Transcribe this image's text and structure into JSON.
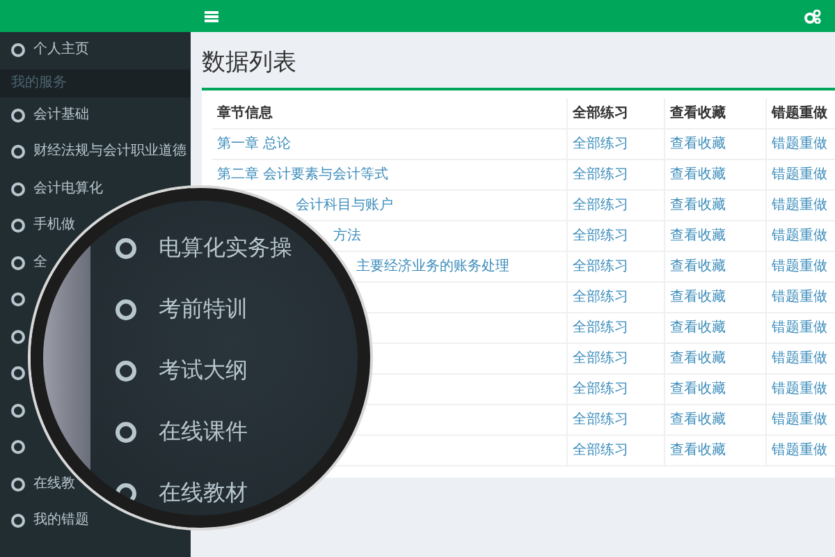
{
  "sidebar": {
    "items": [
      {
        "kind": "item",
        "label": "个人主页"
      },
      {
        "kind": "section",
        "label": "我的服务"
      },
      {
        "kind": "item",
        "label": "会计基础"
      },
      {
        "kind": "item",
        "label": "财经法规与会计职业道德"
      },
      {
        "kind": "item",
        "label": "会计电算化"
      },
      {
        "kind": "item",
        "label": "手机做"
      },
      {
        "kind": "item",
        "label": "全"
      },
      {
        "kind": "item"
      },
      {
        "kind": "item"
      },
      {
        "kind": "item"
      },
      {
        "kind": "item"
      },
      {
        "kind": "item"
      },
      {
        "kind": "item",
        "label": "在线教"
      },
      {
        "kind": "item",
        "label": "我的错题"
      }
    ]
  },
  "page": {
    "title": "数据列表"
  },
  "table": {
    "columns": [
      "章节信息",
      "全部练习",
      "查看收藏",
      "错题重做"
    ],
    "rows": [
      {
        "chapter": "第一章 总论",
        "practice": "全部练习",
        "favorites": "查看收藏",
        "redo": "错题重做"
      },
      {
        "chapter": "第二章 会计要素与会计等式",
        "practice": "全部练习",
        "favorites": "查看收藏",
        "redo": "错题重做"
      },
      {
        "chapter": "会计科目与账户",
        "practice": "全部练习",
        "favorites": "查看收藏",
        "redo": "错题重做"
      },
      {
        "chapter": "方法",
        "practice": "全部练习",
        "favorites": "查看收藏",
        "redo": "错题重做"
      },
      {
        "chapter": "主要经济业务的账务处理",
        "practice": "全部练习",
        "favorites": "查看收藏",
        "redo": "错题重做"
      },
      {
        "practice": "全部练习",
        "favorites": "查看收藏",
        "redo": "错题重做"
      },
      {
        "practice": "全部练习",
        "favorites": "查看收藏",
        "redo": "错题重做"
      },
      {
        "practice": "全部练习",
        "favorites": "查看收藏",
        "redo": "错题重做"
      },
      {
        "practice": "全部练习",
        "favorites": "查看收藏",
        "redo": "错题重做"
      },
      {
        "practice": "全部练习",
        "favorites": "查看收藏",
        "redo": "错题重做"
      },
      {
        "practice": "全部练习",
        "favorites": "查看收藏",
        "redo": "错题重做"
      }
    ]
  },
  "magnifier": {
    "items": [
      "电算化实务操",
      "考前特训",
      "考试大纲",
      "在线课件",
      "在线教材"
    ]
  }
}
